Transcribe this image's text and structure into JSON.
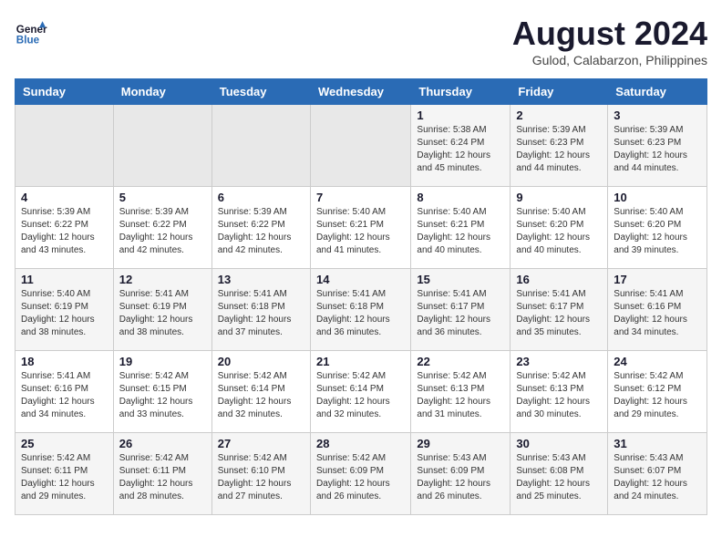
{
  "header": {
    "logo_line1": "General",
    "logo_line2": "Blue",
    "month": "August 2024",
    "location": "Gulod, Calabarzon, Philippines"
  },
  "weekdays": [
    "Sunday",
    "Monday",
    "Tuesday",
    "Wednesday",
    "Thursday",
    "Friday",
    "Saturday"
  ],
  "weeks": [
    [
      {
        "day": "",
        "info": ""
      },
      {
        "day": "",
        "info": ""
      },
      {
        "day": "",
        "info": ""
      },
      {
        "day": "",
        "info": ""
      },
      {
        "day": "1",
        "info": "Sunrise: 5:38 AM\nSunset: 6:24 PM\nDaylight: 12 hours\nand 45 minutes."
      },
      {
        "day": "2",
        "info": "Sunrise: 5:39 AM\nSunset: 6:23 PM\nDaylight: 12 hours\nand 44 minutes."
      },
      {
        "day": "3",
        "info": "Sunrise: 5:39 AM\nSunset: 6:23 PM\nDaylight: 12 hours\nand 44 minutes."
      }
    ],
    [
      {
        "day": "4",
        "info": "Sunrise: 5:39 AM\nSunset: 6:22 PM\nDaylight: 12 hours\nand 43 minutes."
      },
      {
        "day": "5",
        "info": "Sunrise: 5:39 AM\nSunset: 6:22 PM\nDaylight: 12 hours\nand 42 minutes."
      },
      {
        "day": "6",
        "info": "Sunrise: 5:39 AM\nSunset: 6:22 PM\nDaylight: 12 hours\nand 42 minutes."
      },
      {
        "day": "7",
        "info": "Sunrise: 5:40 AM\nSunset: 6:21 PM\nDaylight: 12 hours\nand 41 minutes."
      },
      {
        "day": "8",
        "info": "Sunrise: 5:40 AM\nSunset: 6:21 PM\nDaylight: 12 hours\nand 40 minutes."
      },
      {
        "day": "9",
        "info": "Sunrise: 5:40 AM\nSunset: 6:20 PM\nDaylight: 12 hours\nand 40 minutes."
      },
      {
        "day": "10",
        "info": "Sunrise: 5:40 AM\nSunset: 6:20 PM\nDaylight: 12 hours\nand 39 minutes."
      }
    ],
    [
      {
        "day": "11",
        "info": "Sunrise: 5:40 AM\nSunset: 6:19 PM\nDaylight: 12 hours\nand 38 minutes."
      },
      {
        "day": "12",
        "info": "Sunrise: 5:41 AM\nSunset: 6:19 PM\nDaylight: 12 hours\nand 38 minutes."
      },
      {
        "day": "13",
        "info": "Sunrise: 5:41 AM\nSunset: 6:18 PM\nDaylight: 12 hours\nand 37 minutes."
      },
      {
        "day": "14",
        "info": "Sunrise: 5:41 AM\nSunset: 6:18 PM\nDaylight: 12 hours\nand 36 minutes."
      },
      {
        "day": "15",
        "info": "Sunrise: 5:41 AM\nSunset: 6:17 PM\nDaylight: 12 hours\nand 36 minutes."
      },
      {
        "day": "16",
        "info": "Sunrise: 5:41 AM\nSunset: 6:17 PM\nDaylight: 12 hours\nand 35 minutes."
      },
      {
        "day": "17",
        "info": "Sunrise: 5:41 AM\nSunset: 6:16 PM\nDaylight: 12 hours\nand 34 minutes."
      }
    ],
    [
      {
        "day": "18",
        "info": "Sunrise: 5:41 AM\nSunset: 6:16 PM\nDaylight: 12 hours\nand 34 minutes."
      },
      {
        "day": "19",
        "info": "Sunrise: 5:42 AM\nSunset: 6:15 PM\nDaylight: 12 hours\nand 33 minutes."
      },
      {
        "day": "20",
        "info": "Sunrise: 5:42 AM\nSunset: 6:14 PM\nDaylight: 12 hours\nand 32 minutes."
      },
      {
        "day": "21",
        "info": "Sunrise: 5:42 AM\nSunset: 6:14 PM\nDaylight: 12 hours\nand 32 minutes."
      },
      {
        "day": "22",
        "info": "Sunrise: 5:42 AM\nSunset: 6:13 PM\nDaylight: 12 hours\nand 31 minutes."
      },
      {
        "day": "23",
        "info": "Sunrise: 5:42 AM\nSunset: 6:13 PM\nDaylight: 12 hours\nand 30 minutes."
      },
      {
        "day": "24",
        "info": "Sunrise: 5:42 AM\nSunset: 6:12 PM\nDaylight: 12 hours\nand 29 minutes."
      }
    ],
    [
      {
        "day": "25",
        "info": "Sunrise: 5:42 AM\nSunset: 6:11 PM\nDaylight: 12 hours\nand 29 minutes."
      },
      {
        "day": "26",
        "info": "Sunrise: 5:42 AM\nSunset: 6:11 PM\nDaylight: 12 hours\nand 28 minutes."
      },
      {
        "day": "27",
        "info": "Sunrise: 5:42 AM\nSunset: 6:10 PM\nDaylight: 12 hours\nand 27 minutes."
      },
      {
        "day": "28",
        "info": "Sunrise: 5:42 AM\nSunset: 6:09 PM\nDaylight: 12 hours\nand 26 minutes."
      },
      {
        "day": "29",
        "info": "Sunrise: 5:43 AM\nSunset: 6:09 PM\nDaylight: 12 hours\nand 26 minutes."
      },
      {
        "day": "30",
        "info": "Sunrise: 5:43 AM\nSunset: 6:08 PM\nDaylight: 12 hours\nand 25 minutes."
      },
      {
        "day": "31",
        "info": "Sunrise: 5:43 AM\nSunset: 6:07 PM\nDaylight: 12 hours\nand 24 minutes."
      }
    ]
  ]
}
